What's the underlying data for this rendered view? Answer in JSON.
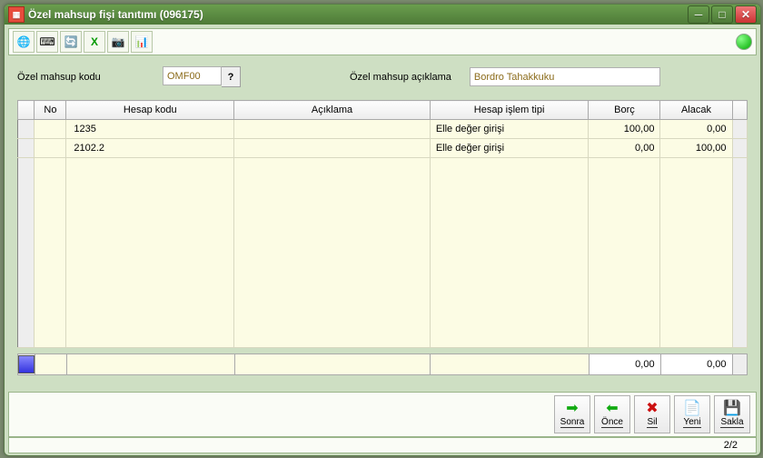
{
  "window": {
    "title": "Özel mahsup fişi tanıtımı (096175)"
  },
  "toolbar_icons": [
    "globe",
    "keyboard",
    "refresh",
    "excel",
    "camera",
    "chart"
  ],
  "form": {
    "code_label": "Özel mahsup kodu",
    "code_value": "OMF00",
    "lookup_symbol": "?",
    "desc_label": "Özel mahsup açıklama",
    "desc_value": "Bordro Tahakkuku"
  },
  "grid": {
    "columns": {
      "no": "No",
      "hesap_kodu": "Hesap kodu",
      "aciklama": "Açıklama",
      "hesap_islem_tipi": "Hesap işlem tipi",
      "borc": "Borç",
      "alacak": "Alacak"
    },
    "rows": [
      {
        "no": "",
        "hesap_kodu": "1235",
        "aciklama": "",
        "tip": "Elle değer girişi",
        "borc": "100,00",
        "alacak": "0,00"
      },
      {
        "no": "",
        "hesap_kodu": "2102.2",
        "aciklama": "",
        "tip": "Elle değer girişi",
        "borc": "0,00",
        "alacak": "100,00"
      }
    ]
  },
  "totals": {
    "borc": "0,00",
    "alacak": "0,00"
  },
  "buttons": {
    "sonra": "Sonra",
    "once": "Önce",
    "sil": "Sil",
    "yeni": "Yeni",
    "sakla": "Sakla"
  },
  "status": {
    "counter": "2/2"
  }
}
